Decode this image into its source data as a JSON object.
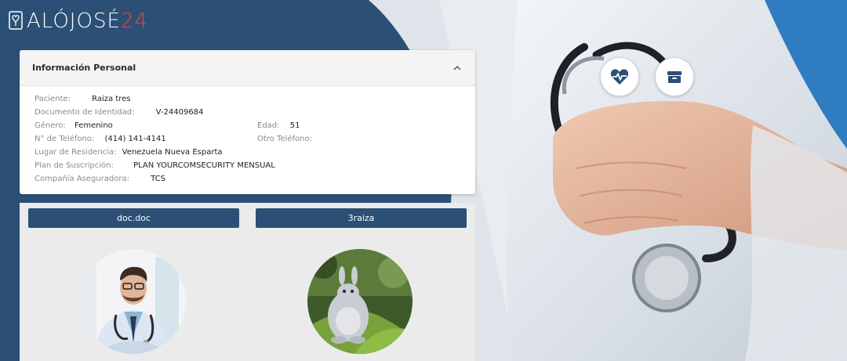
{
  "brand": {
    "name_prefix": "ALÓJOSÉ",
    "name_accent": "24",
    "accent_color": "#e0463e",
    "primary_color": "#2c5075"
  },
  "personal_info": {
    "title": "Información Personal",
    "fields": {
      "patient": {
        "label": "Paciente:",
        "value": "Raiza tres"
      },
      "document": {
        "label": "Documento de Identidad:",
        "value": "V-24409684"
      },
      "gender": {
        "label": "Género:",
        "value": "Femenino"
      },
      "age": {
        "label": "Edad:",
        "value": "51"
      },
      "phone": {
        "label": "N° de Teléfono:",
        "value": "(414) 141-4141"
      },
      "other_phone": {
        "label": "Otro Teléfono:",
        "value": ""
      },
      "residence": {
        "label": "Lugar de Residencia:",
        "value": "Venezuela Nueva Esparta"
      },
      "plan": {
        "label": "Plan de Suscripción:",
        "value": "PLAN YOURCOMSECURITY MENSUAL"
      },
      "insurer": {
        "label": "Compañía Aseguradora:",
        "value": "TCS"
      }
    }
  },
  "documents": [
    {
      "label": "doc.doc",
      "avatar": "doctor-photo"
    },
    {
      "label": "3raiza",
      "avatar": "cartoon-bunny-photo"
    }
  ],
  "actions": [
    {
      "icon": "heartbeat-icon"
    },
    {
      "icon": "archive-box-icon"
    }
  ]
}
